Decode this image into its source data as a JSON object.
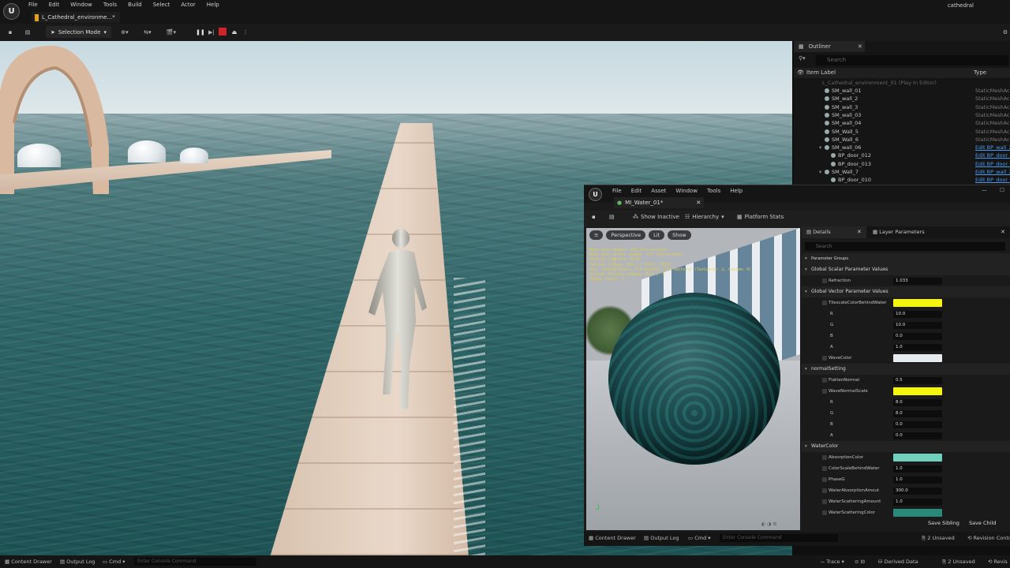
{
  "app": {
    "menus": [
      "File",
      "Edit",
      "Window",
      "Tools",
      "Build",
      "Select",
      "Actor",
      "Help"
    ],
    "doc_tab": "L_Cathedral_environme...*",
    "project": "cathedral"
  },
  "toolbar": {
    "selection_mode": "Selection Mode"
  },
  "outliner": {
    "tab": "Outliner",
    "search_placeholder": "Search",
    "col_label": "Item Label",
    "col_type": "Type",
    "root": "L_Cathedral_environment_01 (Play In Editor)",
    "rows": [
      {
        "name": "SM_wall_01",
        "type": "StaticMeshActor",
        "link": false,
        "indent": 1
      },
      {
        "name": "SM_wall_2",
        "type": "StaticMeshActor",
        "link": false,
        "indent": 1
      },
      {
        "name": "SM_wall_3",
        "type": "StaticMeshActor",
        "link": false,
        "indent": 1
      },
      {
        "name": "SM_wall_03",
        "type": "StaticMeshActor",
        "link": false,
        "indent": 1
      },
      {
        "name": "SM_wall_04",
        "type": "StaticMeshActor",
        "link": false,
        "indent": 1
      },
      {
        "name": "SM_Wall_5",
        "type": "StaticMeshActor",
        "link": false,
        "indent": 1
      },
      {
        "name": "SM_Wall_6",
        "type": "StaticMeshActor",
        "link": false,
        "indent": 1
      },
      {
        "name": "SM_wall_06",
        "type": "Edit BP_wall_2",
        "link": true,
        "indent": 1
      },
      {
        "name": "BP_door_012",
        "type": "Edit BP_door_0",
        "link": true,
        "indent": 2
      },
      {
        "name": "BP_door_013",
        "type": "Edit BP_door_0",
        "link": true,
        "indent": 2
      },
      {
        "name": "SM_Wall_7",
        "type": "Edit BP_wall_2",
        "link": true,
        "indent": 1
      },
      {
        "name": "BP_door_010",
        "type": "Edit BP_door_0",
        "link": true,
        "indent": 2
      }
    ]
  },
  "material_editor": {
    "menus": [
      "File",
      "Edit",
      "Asset",
      "Window",
      "Tools",
      "Help"
    ],
    "tab": "MI_Water_01*",
    "toolbar": {
      "show_inactive": "Show Inactive",
      "hierarchy": "Hierarchy",
      "platform_stats": "Platform Stats"
    },
    "viewport": {
      "perspective": "Perspective",
      "lit": "Lit",
      "show": "Show",
      "stats": [
        "Base pass shader: 371 instructions",
        "Base pass vertex shader: 177 instructions",
        "Texture samplers: 8/16",
        "Texture Lookups (Est.): VS(0), PS(8)",
        "User interpolators: 4/4 Scalars (1/4 Vectors) (TexCoords: 2, Custom: 0)",
        "Virtual Texture Lookups (Est.): 0",
        "Shader Count: 2"
      ]
    },
    "details": {
      "tab_details": "Details",
      "tab_layers": "Layer Parameters",
      "search_placeholder": "Search",
      "rows": [
        {
          "kind": "header",
          "label": "Parameter Groups",
          "indent": 0
        },
        {
          "kind": "group",
          "label": "Global Scalar Parameter Values",
          "indent": 0
        },
        {
          "kind": "value",
          "label": "Refraction",
          "value": "1.033",
          "indent": 2
        },
        {
          "kind": "group",
          "label": "Global Vector Parameter Values",
          "indent": 0
        },
        {
          "kind": "swatch",
          "label": "TilescaleColorBehindWater",
          "color": "#f5f50c",
          "indent": 2
        },
        {
          "kind": "value",
          "label": "R",
          "value": "10.0",
          "indent": 3
        },
        {
          "kind": "value",
          "label": "G",
          "value": "10.0",
          "indent": 3
        },
        {
          "kind": "value",
          "label": "B",
          "value": "0.0",
          "indent": 3
        },
        {
          "kind": "value",
          "label": "A",
          "value": "1.0",
          "indent": 3
        },
        {
          "kind": "swatch",
          "label": "WaveColor",
          "color": "#e8ebed",
          "indent": 2
        },
        {
          "kind": "group",
          "label": "normalSetting",
          "indent": 0
        },
        {
          "kind": "value",
          "label": "FlattenNormal",
          "value": "0.5",
          "indent": 2
        },
        {
          "kind": "swatch",
          "label": "WaveNormalScale",
          "color": "#f5f50c",
          "indent": 2
        },
        {
          "kind": "value",
          "label": "R",
          "value": "8.0",
          "indent": 3
        },
        {
          "kind": "value",
          "label": "G",
          "value": "8.0",
          "indent": 3
        },
        {
          "kind": "value",
          "label": "B",
          "value": "0.0",
          "indent": 3
        },
        {
          "kind": "value",
          "label": "A",
          "value": "0.0",
          "indent": 3
        },
        {
          "kind": "group",
          "label": "WaterColor",
          "indent": 0
        },
        {
          "kind": "swatch",
          "label": "AbsorptionColor",
          "color": "#6fd1bd",
          "indent": 2
        },
        {
          "kind": "value",
          "label": "ColorScaleBehindWater",
          "value": "1.0",
          "indent": 2
        },
        {
          "kind": "value",
          "label": "PhaseG",
          "value": "1.0",
          "indent": 2
        },
        {
          "kind": "value",
          "label": "WaterAbsorptionAmout",
          "value": "300.0",
          "indent": 2
        },
        {
          "kind": "value",
          "label": "WaterScatteringAmount",
          "value": "1.0",
          "indent": 2
        },
        {
          "kind": "swatch",
          "label": "WaterScatteringColor",
          "color": "#2a8a7a",
          "indent": 2
        }
      ]
    },
    "save_sibling": "Save Sibling",
    "save_child": "Save Child",
    "bottom": {
      "content_drawer": "Content Drawer",
      "output_log": "Output Log",
      "cmd": "Cmd",
      "console_placeholder": "Enter Console Command",
      "unsaved": "2 Unsaved",
      "revision": "Revision Contr"
    }
  },
  "statusbar": {
    "content_drawer": "Content Drawer",
    "output_log": "Output Log",
    "cmd": "Cmd",
    "console_placeholder": "Enter Console Command",
    "trace": "Trace",
    "derived_data": "Derived Data",
    "unsaved": "2 Unsaved",
    "revision": "Revis"
  }
}
